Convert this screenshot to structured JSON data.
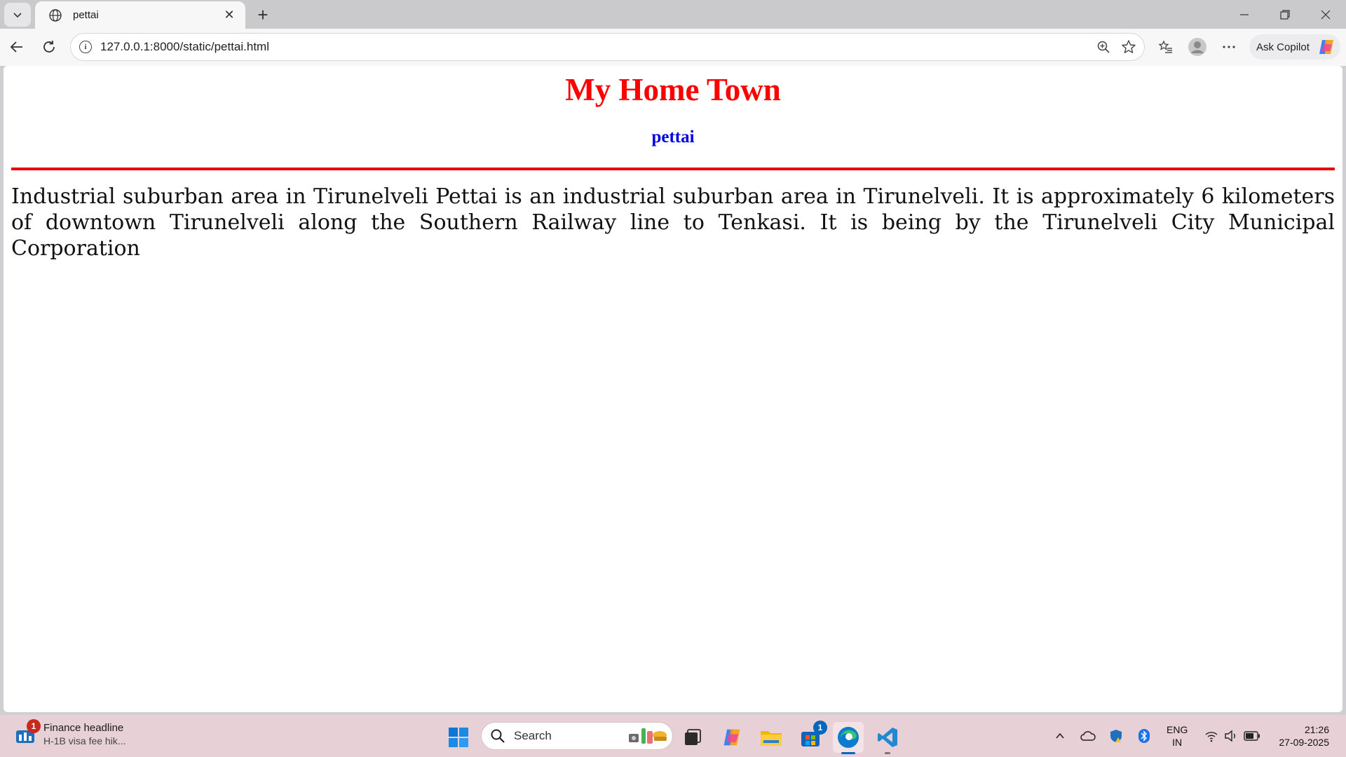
{
  "browser": {
    "tab_title": "pettai",
    "url": "127.0.0.1:8000/static/pettai.html",
    "copilot_label": "Ask Copilot"
  },
  "page": {
    "heading": "My Home Town",
    "subheading": "pettai",
    "paragraph": "Industrial suburban area in Tirunelveli Pettai is an industrial suburban area in Tirunelveli. It is approximately 6 kilometers of downtown Tirunelveli along the Southern Railway line to Tenkasi. It is being by the Tirunelveli City Municipal Corporation"
  },
  "taskbar": {
    "widget_title": "Finance headline",
    "widget_subtitle": "H-1B visa fee hik...",
    "widget_badge": "1",
    "search_placeholder": "Search",
    "store_badge": "1",
    "lang_line1": "ENG",
    "lang_line2": "IN",
    "time": "21:26",
    "date": "27-09-2025"
  },
  "colors": {
    "heading": "#ff0000",
    "subheading": "#0000e0",
    "rule": "#e8000b"
  }
}
